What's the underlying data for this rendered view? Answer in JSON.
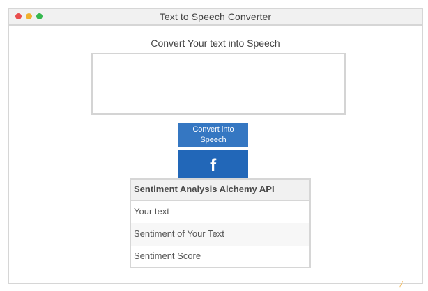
{
  "window": {
    "title": "Text to Speech Converter"
  },
  "main": {
    "prompt": "Convert Your text into Speech",
    "text_input_value": "",
    "convert_button_label": "Convert into Speech",
    "facebook_icon": "facebook-f-icon"
  },
  "sentiment": {
    "header": "Sentiment Analysis Alchemy API",
    "rows": [
      "Your text",
      "Sentiment of Your Text",
      "Sentiment Score"
    ]
  },
  "colors": {
    "convert_button": "#3577c2",
    "facebook_button": "#2267b8",
    "close_dot": "#e94e4e",
    "minimize_dot": "#f0b12f",
    "maximize_dot": "#35b84f"
  }
}
